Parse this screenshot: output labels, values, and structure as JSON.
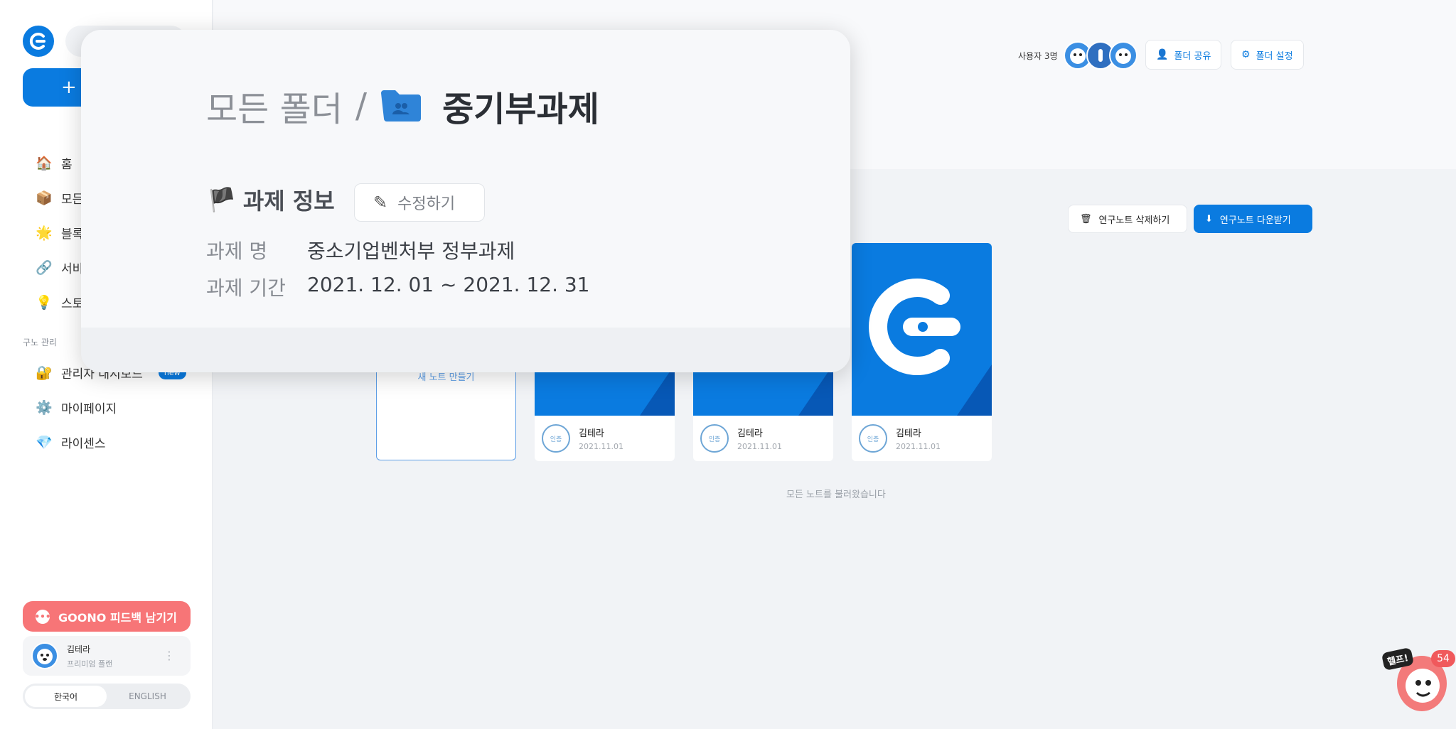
{
  "sidebar": {
    "nav": [
      {
        "icon": "house-icon",
        "glyph": "🏠",
        "label": "홈"
      },
      {
        "icon": "box-icon",
        "glyph": "📦",
        "label": "모든"
      },
      {
        "icon": "sparkle-icon",
        "glyph": "🌟",
        "label": "블록"
      },
      {
        "icon": "link-icon",
        "glyph": "🔗",
        "label": "서비"
      },
      {
        "icon": "bulb-icon",
        "glyph": "💡",
        "label": "스토"
      }
    ],
    "section_label": "구노 관리",
    "admin": {
      "glyph": "🔐",
      "label": "관리자 대시보드",
      "badge": "new"
    },
    "mypage": {
      "glyph": "⚙️",
      "label": "마이페이지"
    },
    "license": {
      "glyph": "💎",
      "label": "라이센스"
    },
    "feedback": "GOONO 피드백 남기기",
    "user": {
      "name": "김테라",
      "plan": "프리미엄 플랜"
    },
    "lang": {
      "ko": "한국어",
      "en": "ENGLISH"
    }
  },
  "header": {
    "users_count": "사용자 3명",
    "share_button": "폴더 공유",
    "settings_button": "폴더 설정"
  },
  "actions": {
    "delete": "연구노트 삭제하기",
    "download": "연구노트 다운받기"
  },
  "notes": {
    "new_note": "새 노트 만들기",
    "items": [
      {
        "author": "김테라",
        "date": "2021.11.01",
        "stamp": "인증"
      },
      {
        "author": "김테라",
        "date": "2021.11.01",
        "stamp": "인증"
      },
      {
        "author": "김테라",
        "date": "2021.11.01",
        "stamp": "인증"
      }
    ],
    "loaded": "모든 노트를 불러왔습니다"
  },
  "popup": {
    "breadcrumb_root": "모든 폴더",
    "breadcrumb_sep": "/",
    "folder_name": "중기부과제",
    "info_title": "과제 정보",
    "edit_button": "수정하기",
    "rows": [
      {
        "key": "과제 명",
        "value": "중소기업벤처부 정부과제"
      },
      {
        "key": "과제 기간",
        "value": "2021. 12. 01 ~ 2021. 12. 31"
      }
    ]
  },
  "help": {
    "bubble": "헬프!",
    "count": "54"
  },
  "colors": {
    "primary": "#0a7be0",
    "feedback": "#f77577",
    "fold": "#0758b6"
  }
}
